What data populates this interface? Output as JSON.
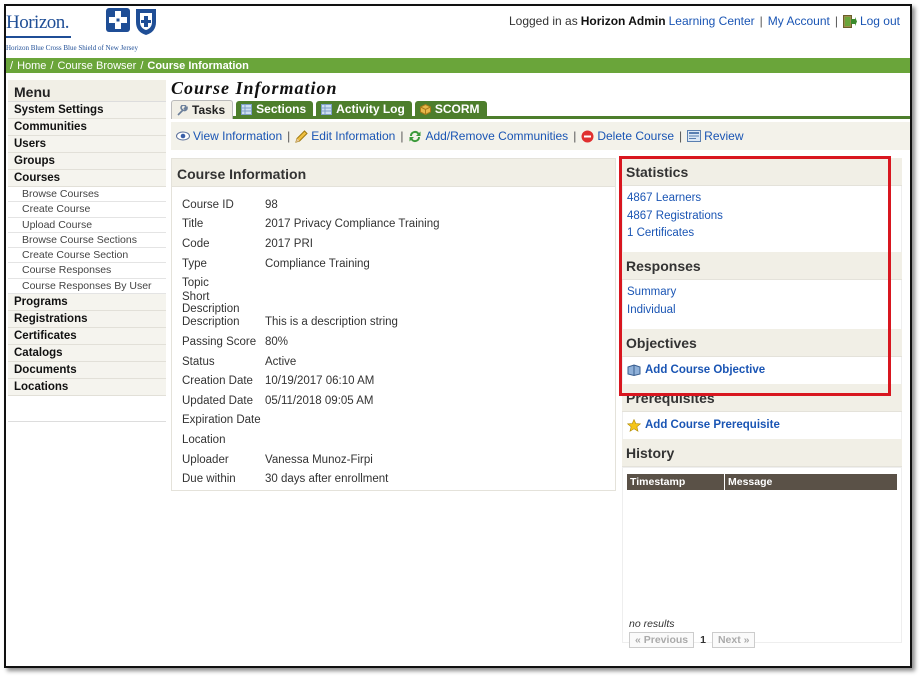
{
  "brand": {
    "name": "Horizon.",
    "subtitle": "Horizon Blue Cross Blue Shield of New Jersey"
  },
  "user_bar": {
    "logged_in_prefix": "Logged in as",
    "user_name": "Horizon Admin",
    "learning_center": "Learning Center",
    "my_account": "My Account",
    "logout": "Log out",
    "separator": "|"
  },
  "breadcrumb": {
    "separator": "/",
    "home": "Home",
    "course_browser": "Course Browser",
    "current": "Course Information"
  },
  "sidebar": {
    "title": "Menu",
    "system_settings": "System Settings",
    "communities": "Communities",
    "users": "Users",
    "groups": "Groups",
    "courses": "Courses",
    "course_subitems": [
      "Browse Courses",
      "Create Course",
      "Upload Course",
      "Browse Course Sections",
      "Create Course Section",
      "Course Responses",
      "Course Responses By User"
    ],
    "programs": "Programs",
    "registrations": "Registrations",
    "certificates": "Certificates",
    "catalogs": "Catalogs",
    "documents": "Documents",
    "locations": "Locations"
  },
  "page": {
    "title": "Course Information"
  },
  "tabs": {
    "tasks": "Tasks",
    "sections": "Sections",
    "activity_log": "Activity Log",
    "scorm": "SCORM"
  },
  "actions": {
    "view_information": "View Information",
    "edit_information": "Edit Information",
    "add_remove_communities": "Add/Remove Communities",
    "delete_course": "Delete Course",
    "review": "Review",
    "separator": "|"
  },
  "course_info": {
    "heading": "Course Information",
    "rows": [
      {
        "label": "Course ID",
        "value": "98"
      },
      {
        "label": "Title",
        "value": "2017 Privacy Compliance Training"
      },
      {
        "label": "Code",
        "value": "2017 PRI"
      },
      {
        "label": "Type",
        "value": "Compliance Training"
      },
      {
        "label": "Topic",
        "value": ""
      },
      {
        "label": "Short Description",
        "value": ""
      },
      {
        "label": "Description",
        "value": "This is a description string"
      },
      {
        "label": "Passing Score",
        "value": "80%"
      },
      {
        "label": "Status",
        "value": "Active"
      },
      {
        "label": "Creation Date",
        "value": "10/19/2017 06:10 AM"
      },
      {
        "label": "Updated Date",
        "value": "05/11/2018 09:05 AM"
      },
      {
        "label": "Expiration Date",
        "value": ""
      },
      {
        "label": "Location",
        "value": ""
      },
      {
        "label": "Uploader",
        "value": "Vanessa Munoz-Firpi"
      },
      {
        "label": "Due within",
        "value": "30 days after enrollment"
      }
    ]
  },
  "statistics": {
    "heading": "Statistics",
    "learners": "4867 Learners",
    "registrations": "4867 Registrations",
    "certificates": "1 Certificates"
  },
  "responses": {
    "heading": "Responses",
    "summary": "Summary",
    "individual": "Individual"
  },
  "objectives": {
    "heading": "Objectives",
    "add": "Add Course Objective"
  },
  "prerequisites": {
    "heading": "Prerequisites",
    "add": "Add Course Prerequisite"
  },
  "history": {
    "heading": "History",
    "col_timestamp": "Timestamp",
    "col_message": "Message",
    "no_results": "no results",
    "previous": "« Previous",
    "current_page": "1",
    "next": "Next »"
  },
  "colors": {
    "brand_blue": "#1f4e96",
    "nav_green": "#6aa53a",
    "tab_green": "#4d7e2c",
    "highlight_red": "#d8161f",
    "link_blue": "#1a55b4"
  }
}
